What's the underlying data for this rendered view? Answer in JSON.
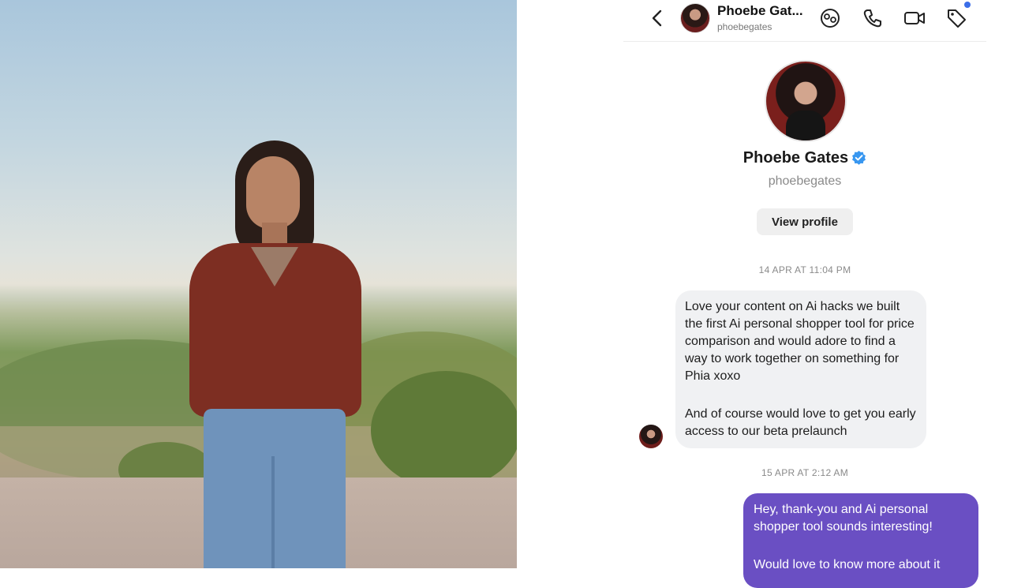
{
  "header": {
    "name": "Phoebe Gat...",
    "username": "phoebegates",
    "icons": [
      "back-arrow-icon",
      "audio-call-effects-icon",
      "phone-icon",
      "video-camera-icon",
      "tag-icon"
    ]
  },
  "profile": {
    "name": "Phoebe Gates",
    "username": "phoebegates",
    "view_profile_label": "View profile",
    "verified_color": "#3897f0"
  },
  "messages": [
    {
      "timestamp": "14 APR AT 11:04 PM",
      "direction": "incoming",
      "paragraphs": [
        "Love your content on Ai hacks we built the first Ai personal shopper tool for price comparison and would adore to find a way to work together on something for Phia xoxo",
        "And of course would love to get you early access to our beta prelaunch"
      ]
    },
    {
      "timestamp": "15 APR AT 2:12 AM",
      "direction": "outgoing",
      "paragraphs": [
        "Hey, thank-you and Ai personal shopper tool sounds interesting!",
        "Would love to know more about it"
      ]
    }
  ],
  "colors": {
    "outgoing_bubble": "#6a4fc3",
    "incoming_bubble": "#f0f1f3",
    "notification_dot": "#3b6ee8"
  }
}
